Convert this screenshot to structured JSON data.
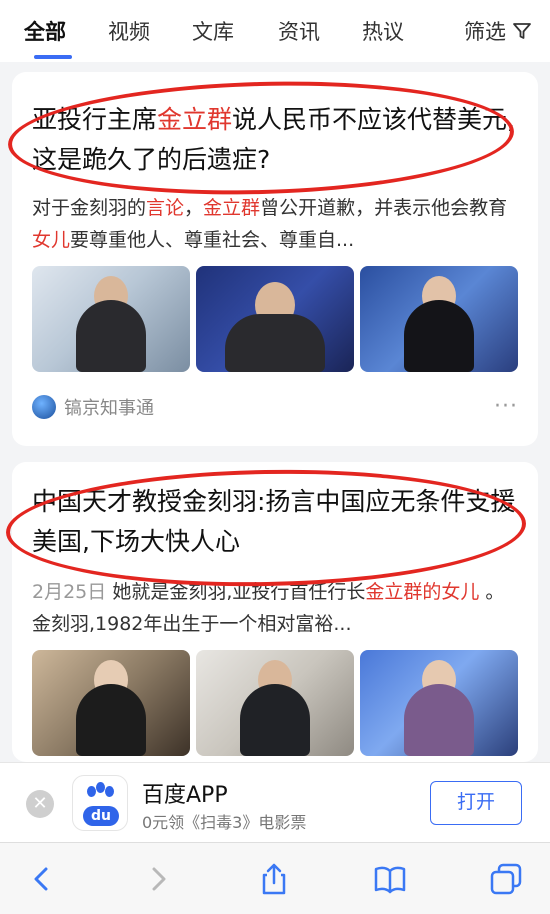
{
  "tabs": [
    "全部",
    "视频",
    "文库",
    "资讯",
    "热议"
  ],
  "filter_label": "筛选",
  "results": [
    {
      "title_pre": "亚投行主席",
      "title_hl": "金立群",
      "title_post": "说人民币不应该代替美元,这是跪久了的后遗症?",
      "snippet": [
        {
          "t": "对于金刻羽的"
        },
        {
          "t": "言论",
          "hl": true
        },
        {
          "t": "，"
        },
        {
          "t": "金立群",
          "hl": true
        },
        {
          "t": "曾公开道歉，并表示他会教育"
        },
        {
          "t": "女儿",
          "hl": true
        },
        {
          "t": "要尊重他人、尊重社会、尊重自..."
        }
      ],
      "source": "镐京知事通",
      "more": "···"
    },
    {
      "title": "中国天才教授金刻羽:扬言中国应无条件支援美国,下场大快人心",
      "date": "2月25日",
      "snippet": [
        {
          "t": "她就是金刻羽,亚投行首任行长"
        },
        {
          "t": "金立群",
          "hl": true
        },
        {
          "t": "的女儿",
          "hl": true
        },
        {
          "t": " 。 金刻羽,1982年出生于一个相对富裕..."
        }
      ]
    }
  ],
  "banner": {
    "app_name": "百度APP",
    "app_icon_text": "du",
    "subtitle": "0元领《扫毒3》电影票",
    "open_label": "打开"
  },
  "colors": {
    "accent": "#3a6cf4",
    "highlight": "#e0372e",
    "annotation": "#e32620"
  }
}
